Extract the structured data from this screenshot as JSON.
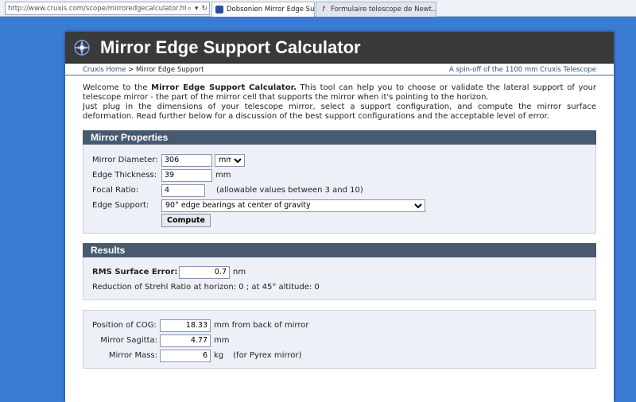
{
  "browser": {
    "url": "http://www.cruxis.com/scope/mirroredgecalculator.htm",
    "tabs": [
      {
        "label": "Dobsonien Mirror Edge Sup...",
        "close": "×"
      },
      {
        "label": "Formulaire telescope de Newt...",
        "close": ""
      }
    ]
  },
  "header": {
    "title": "Mirror Edge Support Calculator",
    "breadcrumb_home": "Cruxis Home",
    "breadcrumb_sep": " > ",
    "breadcrumb_current": "Mirror Edge Support",
    "right_link": "A spin-off of the 1100 mm Cruxis Telescope"
  },
  "intro": {
    "p1_prefix": "Welcome to the ",
    "p1_bold": "Mirror Edge Support Calculator.",
    "p1_rest": " This tool can help you to choose or validate the lateral support of your telescope mirror - the part of the mirror cell that supports the mirror when it's pointing to the horizon.",
    "p2": "Just plug in the dimensions of your telescope mirror, select a support configuration, and compute the mirror surface deformation. Read further below for a discussion of the best support configurations and the acceptable level of error."
  },
  "mirror_properties": {
    "heading": "Mirror Properties",
    "diameter_label": "Mirror Diameter:",
    "diameter_value": "306",
    "diameter_unit": "mm",
    "thickness_label": "Edge Thickness:",
    "thickness_value": "39",
    "thickness_unit": "mm",
    "focal_label": "Focal Ratio:",
    "focal_value": "4",
    "focal_note": "(allowable values between 3 and 10)",
    "support_label": "Edge Support:",
    "support_value": "90° edge bearings at center of gravity",
    "compute_label": "Compute"
  },
  "results": {
    "heading": "Results",
    "rms_label": "RMS Surface Error:",
    "rms_value": "0.7",
    "rms_unit": "nm",
    "strehl_text": "Reduction of Strehl Ratio at horizon: 0 ; at 45° altitude: 0",
    "cog_label": "Position of COG:",
    "cog_value": "18.33",
    "cog_unit": "mm from back of mirror",
    "sagitta_label": "Mirror Sagitta:",
    "sagitta_value": "4.77",
    "sagitta_unit": "mm",
    "mass_label": "Mirror Mass:",
    "mass_value": "6",
    "mass_unit": "kg",
    "mass_note": "(for Pyrex mirror)"
  }
}
